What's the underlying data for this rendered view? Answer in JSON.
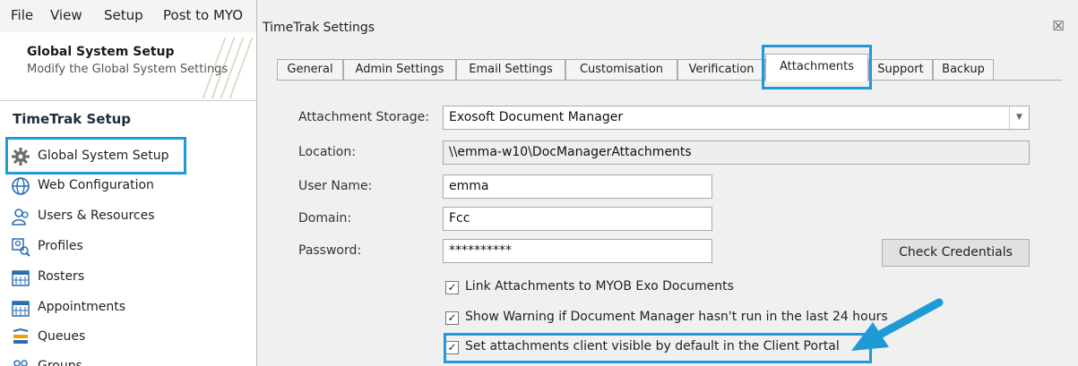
{
  "menubar": {
    "items": [
      "File",
      "View",
      "Setup",
      "Post to MYO"
    ]
  },
  "left_header": {
    "title": "Global System Setup",
    "subtitle": "Modify the Global System Settings"
  },
  "setup_section": {
    "title": "TimeTrak Setup",
    "items": [
      {
        "label": "Global System Setup",
        "icon": "gear-icon"
      },
      {
        "label": "Web Configuration",
        "icon": "globe-icon"
      },
      {
        "label": "Users & Resources",
        "icon": "users-icon"
      },
      {
        "label": "Profiles",
        "icon": "profiles-icon"
      },
      {
        "label": "Rosters",
        "icon": "calendar-icon"
      },
      {
        "label": "Appointments",
        "icon": "calendar-icon"
      },
      {
        "label": "Queues",
        "icon": "queues-icon"
      },
      {
        "label": "Groups",
        "icon": "groups-icon"
      }
    ]
  },
  "dialog": {
    "title": "TimeTrak Settings",
    "close_glyph": "☒",
    "tabs": [
      "General",
      "Admin Settings",
      "Email Settings",
      "Customisation",
      "Verification",
      "Attachments",
      "Support",
      "Backup"
    ],
    "active_tab": "Attachments"
  },
  "attachments": {
    "storage_label": "Attachment Storage:",
    "storage_value": "Exosoft Document Manager",
    "location_label": "Location:",
    "location_value": "\\\\emma-w10\\DocManagerAttachments",
    "username_label": "User Name:",
    "username_value": "emma",
    "domain_label": "Domain:",
    "domain_value": "Fcc",
    "password_label": "Password:",
    "password_value": "**********",
    "check_credentials_label": "Check Credentials",
    "checkboxes": [
      {
        "label": "Link Attachments to MYOB Exo Documents",
        "checked": true
      },
      {
        "label": "Show Warning if Document Manager hasn't run in the last 24 hours",
        "checked": true
      },
      {
        "label": "Set attachments client visible by default in the Client Portal",
        "checked": true
      }
    ]
  },
  "colors": {
    "highlight": "#1f9ad6",
    "arrow": "#1f9ad6"
  }
}
